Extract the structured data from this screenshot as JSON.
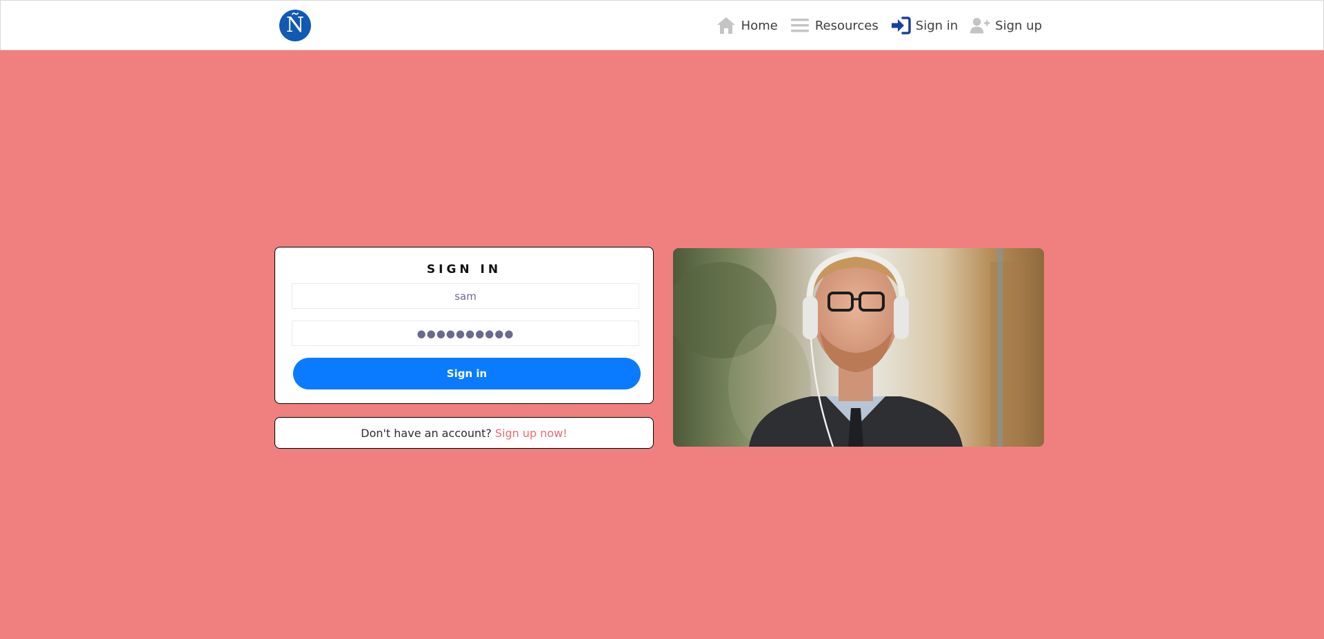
{
  "header": {
    "logo_text": "Ñ",
    "nav": [
      {
        "label": "Home",
        "icon": "home-icon"
      },
      {
        "label": "Resources",
        "icon": "menu-icon"
      },
      {
        "label": "Sign in",
        "icon": "sign-in-icon"
      },
      {
        "label": "Sign up",
        "icon": "user-plus-icon"
      }
    ]
  },
  "signin": {
    "title": "SIGN IN",
    "username_value": "sam",
    "password_value": "●●●●●●●●●●",
    "button_label": "Sign in"
  },
  "signup": {
    "prompt": "Don't have an account?",
    "link": "Sign up now!"
  },
  "colors": {
    "page_background": "#f08080",
    "accent_button": "#0a7bff",
    "logo": "#1159b3",
    "link": "#f06a6a"
  }
}
